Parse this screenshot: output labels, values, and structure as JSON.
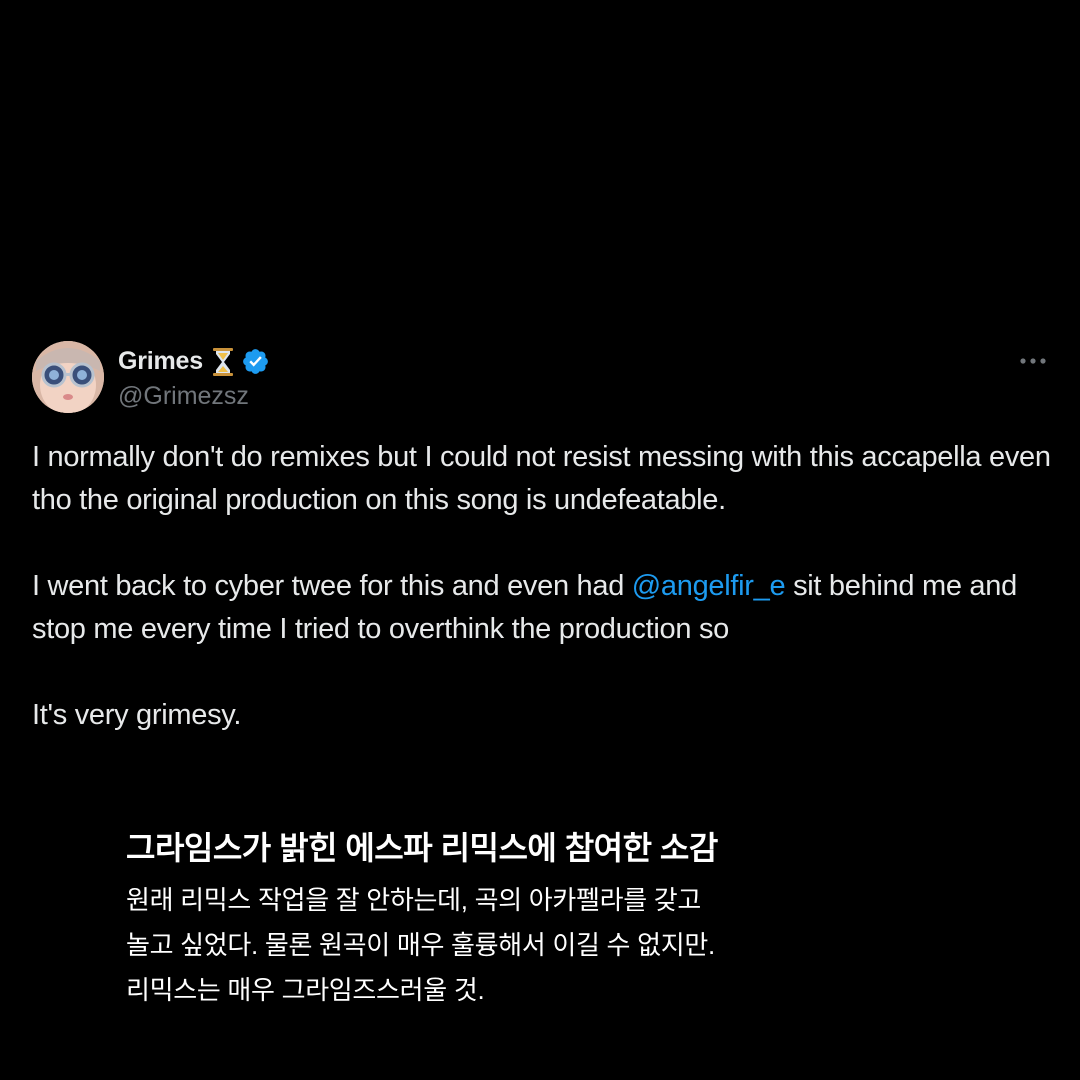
{
  "tweet": {
    "display_name": "Grimes",
    "handle": "@Grimezsz",
    "verified": true,
    "name_emoji_icon": "hourglass-icon",
    "verified_badge_icon": "verified-badge-icon",
    "more_icon": "more-options-icon",
    "accent_color": "#1d9bf0",
    "paragraphs": {
      "p1": "I normally don't do remixes but I could not resist messing with this accapella even tho the original production on this song is undefeatable.",
      "p2_before": "I went back to cyber twee for this and even had ",
      "p2_mention": "@angelfir_e",
      "p2_after": " sit behind me and stop me every time I tried to overthink the production so",
      "p3": "It's very grimesy."
    }
  },
  "caption": {
    "title": "그라임스가 밝힌 에스파 리믹스에 참여한 소감",
    "lines": [
      "원래 리믹스 작업을 잘 안하는데, 곡의 아카펠라를 갖고",
      "놀고 싶었다. 물론 원곡이 매우 훌륭해서 이길 수 없지만.",
      "리믹스는 매우 그라임즈스러울 것."
    ]
  }
}
